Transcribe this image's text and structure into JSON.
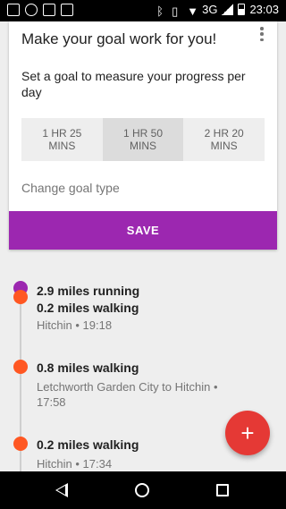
{
  "status_bar": {
    "network": "3G",
    "time": "23:03"
  },
  "goal_card": {
    "title": "Make your goal work for you!",
    "subtitle": "Set a goal to measure your progress per day",
    "options": [
      {
        "line1": "1 HR 25",
        "line2": "MINS"
      },
      {
        "line1": "1 HR 50",
        "line2": "MINS"
      },
      {
        "line1": "2 HR 20",
        "line2": "MINS"
      }
    ],
    "selected_option": 1,
    "change_goal_label": "Change goal type",
    "save_label": "SAVE"
  },
  "timeline": [
    {
      "activities": [
        "2.9 miles running",
        "0.2 miles walking"
      ],
      "meta": "Hitchin • 19:18",
      "dots": [
        "purple",
        "orange"
      ]
    },
    {
      "activities": [
        "0.8 miles walking"
      ],
      "meta": "Letchworth Garden City to Hitchin • 17:58",
      "dots": [
        "orange"
      ]
    },
    {
      "activities": [
        "0.2 miles walking"
      ],
      "meta": "Hitchin • 17:34",
      "dots": [
        "orange"
      ]
    }
  ],
  "fab": {
    "label": "+"
  },
  "colors": {
    "accent": "#9c27b0",
    "walking": "#ff5722",
    "fab": "#e53935"
  },
  "icons": {
    "status_left": [
      "image-icon",
      "usb-icon",
      "instagram-icon",
      "download-icon"
    ],
    "status_right": [
      "bluetooth-icon",
      "vibrate-icon",
      "wifi-icon",
      "signal-icon",
      "battery-icon"
    ],
    "nav": [
      "back-icon",
      "home-icon",
      "recents-icon"
    ]
  }
}
